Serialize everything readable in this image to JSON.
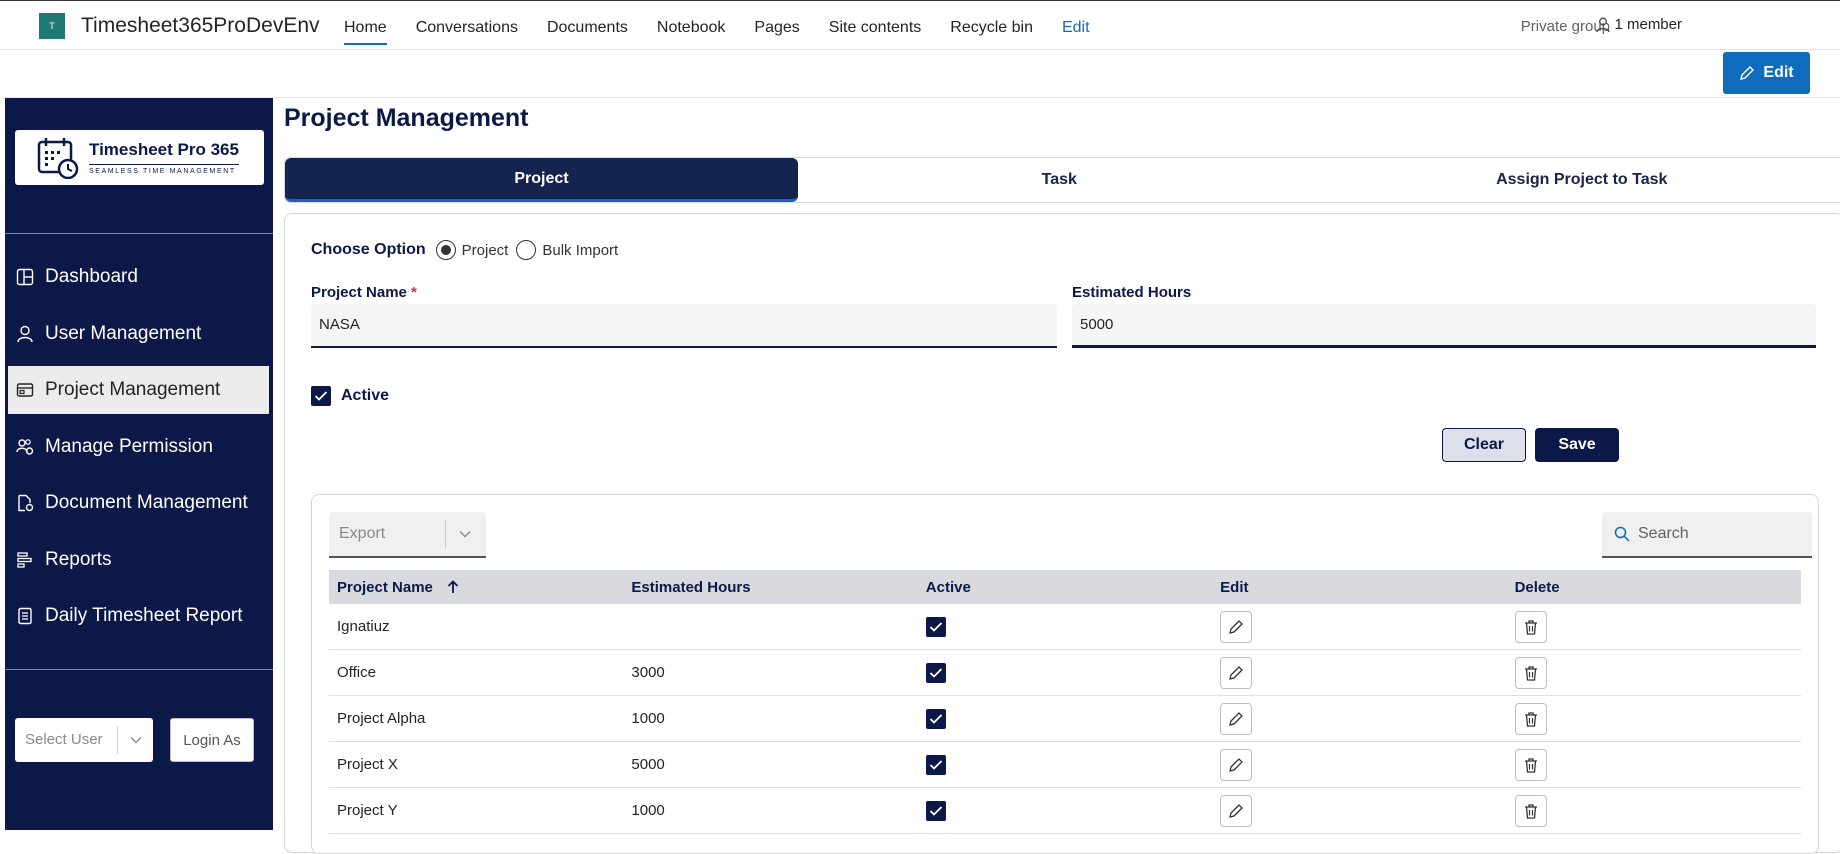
{
  "site": {
    "logo_letter": "T",
    "title": "Timesheet365ProDevEnv",
    "nav": [
      {
        "label": "Home"
      },
      {
        "label": "Conversations"
      },
      {
        "label": "Documents"
      },
      {
        "label": "Notebook"
      },
      {
        "label": "Pages"
      },
      {
        "label": "Site contents"
      },
      {
        "label": "Recycle bin"
      },
      {
        "label": "Edit"
      }
    ],
    "group_type": "Private group",
    "members": "1 member",
    "edit_button": "Edit"
  },
  "sidebar": {
    "brand_name": "Timesheet Pro 365",
    "brand_tagline": "SEAMLESS TIME MANAGEMENT",
    "items": [
      {
        "label": "Dashboard",
        "icon": "dashboard-icon"
      },
      {
        "label": "User Management",
        "icon": "user-icon"
      },
      {
        "label": "Project Management",
        "icon": "folder-icon"
      },
      {
        "label": "Manage Permission",
        "icon": "people-settings-icon"
      },
      {
        "label": "Document Management",
        "icon": "document-settings-icon"
      },
      {
        "label": "Reports",
        "icon": "reports-icon"
      },
      {
        "label": "Daily Timesheet Report",
        "icon": "report-list-icon"
      }
    ],
    "active_index": 2,
    "select_user_placeholder": "Select User",
    "login_as": "Login As"
  },
  "main": {
    "title": "Project Management",
    "tabs": [
      {
        "label": "Project"
      },
      {
        "label": "Task"
      },
      {
        "label": "Assign Project to Task"
      }
    ],
    "active_tab": 0,
    "choose_option_label": "Choose Option",
    "options": [
      {
        "label": "Project",
        "selected": true
      },
      {
        "label": "Bulk Import",
        "selected": false
      }
    ],
    "project_name_label": "Project Name",
    "required_mark": "*",
    "project_name_value": "NASA",
    "estimated_hours_label": "Estimated Hours",
    "estimated_hours_value": "5000",
    "active_label": "Active",
    "clear_button": "Clear",
    "save_button": "Save",
    "export_placeholder": "Export",
    "search_placeholder": "Search",
    "table": {
      "columns": [
        "Project Name",
        "Estimated Hours",
        "Active",
        "Edit",
        "Delete"
      ],
      "rows": [
        {
          "name": "Ignatiuz",
          "hours": "",
          "active": true
        },
        {
          "name": "Office",
          "hours": "3000",
          "active": true
        },
        {
          "name": "Project Alpha",
          "hours": "1000",
          "active": true
        },
        {
          "name": "Project X",
          "hours": "5000",
          "active": true
        },
        {
          "name": "Project Y",
          "hours": "1000",
          "active": true
        }
      ]
    }
  },
  "colors": {
    "navy": "#0c1848",
    "accent_blue": "#0f6cbd"
  }
}
